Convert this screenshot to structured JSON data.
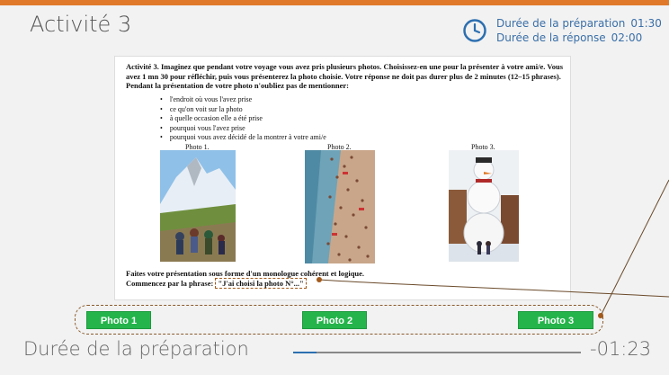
{
  "header": {
    "title": "Activité 3",
    "timer": {
      "prep_label": "Durée de la préparation",
      "prep_time": "01:30",
      "answer_label": "Durée de la réponse",
      "answer_time": "02:00"
    }
  },
  "document": {
    "instructions": "Activité 3. Imaginez que pendant votre voyage vous avez pris plusieurs photos. Choisissez-en une pour la présenter à votre ami/e. Vous avez 1 mn 30 pour réfléchir, puis vous présenterez la photo choisie. Votre réponse ne doit pas durer plus de 2 minutes (12–15 phrases). Pendant la présentation de votre photo n'oubliez pas de mentionner:",
    "bullets": [
      "l'endroit où vous l'avez prise",
      "ce qu'on voit sur la photo",
      "à quelle occasion elle a été prise",
      "pourquoi vous l'avez prise",
      "pourquoi vous avez décidé de la montrer à votre ami/e"
    ],
    "photos": [
      {
        "label": "Photo 1.",
        "subject": "mountain-hikers"
      },
      {
        "label": "Photo 2.",
        "subject": "crowded-beach"
      },
      {
        "label": "Photo 3.",
        "subject": "giant-snowman"
      }
    ],
    "outro_line1": "Faites votre présentation sous forme d'un monologue cohérent et logique.",
    "outro_line2_prefix": "Commencez par la phrase: ",
    "outro_quote": "\"J'ai choisi la photo N°...\""
  },
  "buttons": [
    "Photo 1",
    "Photo 2",
    "Photo 3"
  ],
  "footer": {
    "label": "Durée de la préparation",
    "countdown": "-01:23",
    "elapsed_fraction": 0.08
  },
  "colors": {
    "accent": "#e07a2a",
    "button_green": "#24b44b",
    "timer_blue": "#3a6fa8",
    "annotation_brown": "#a35a1b"
  }
}
